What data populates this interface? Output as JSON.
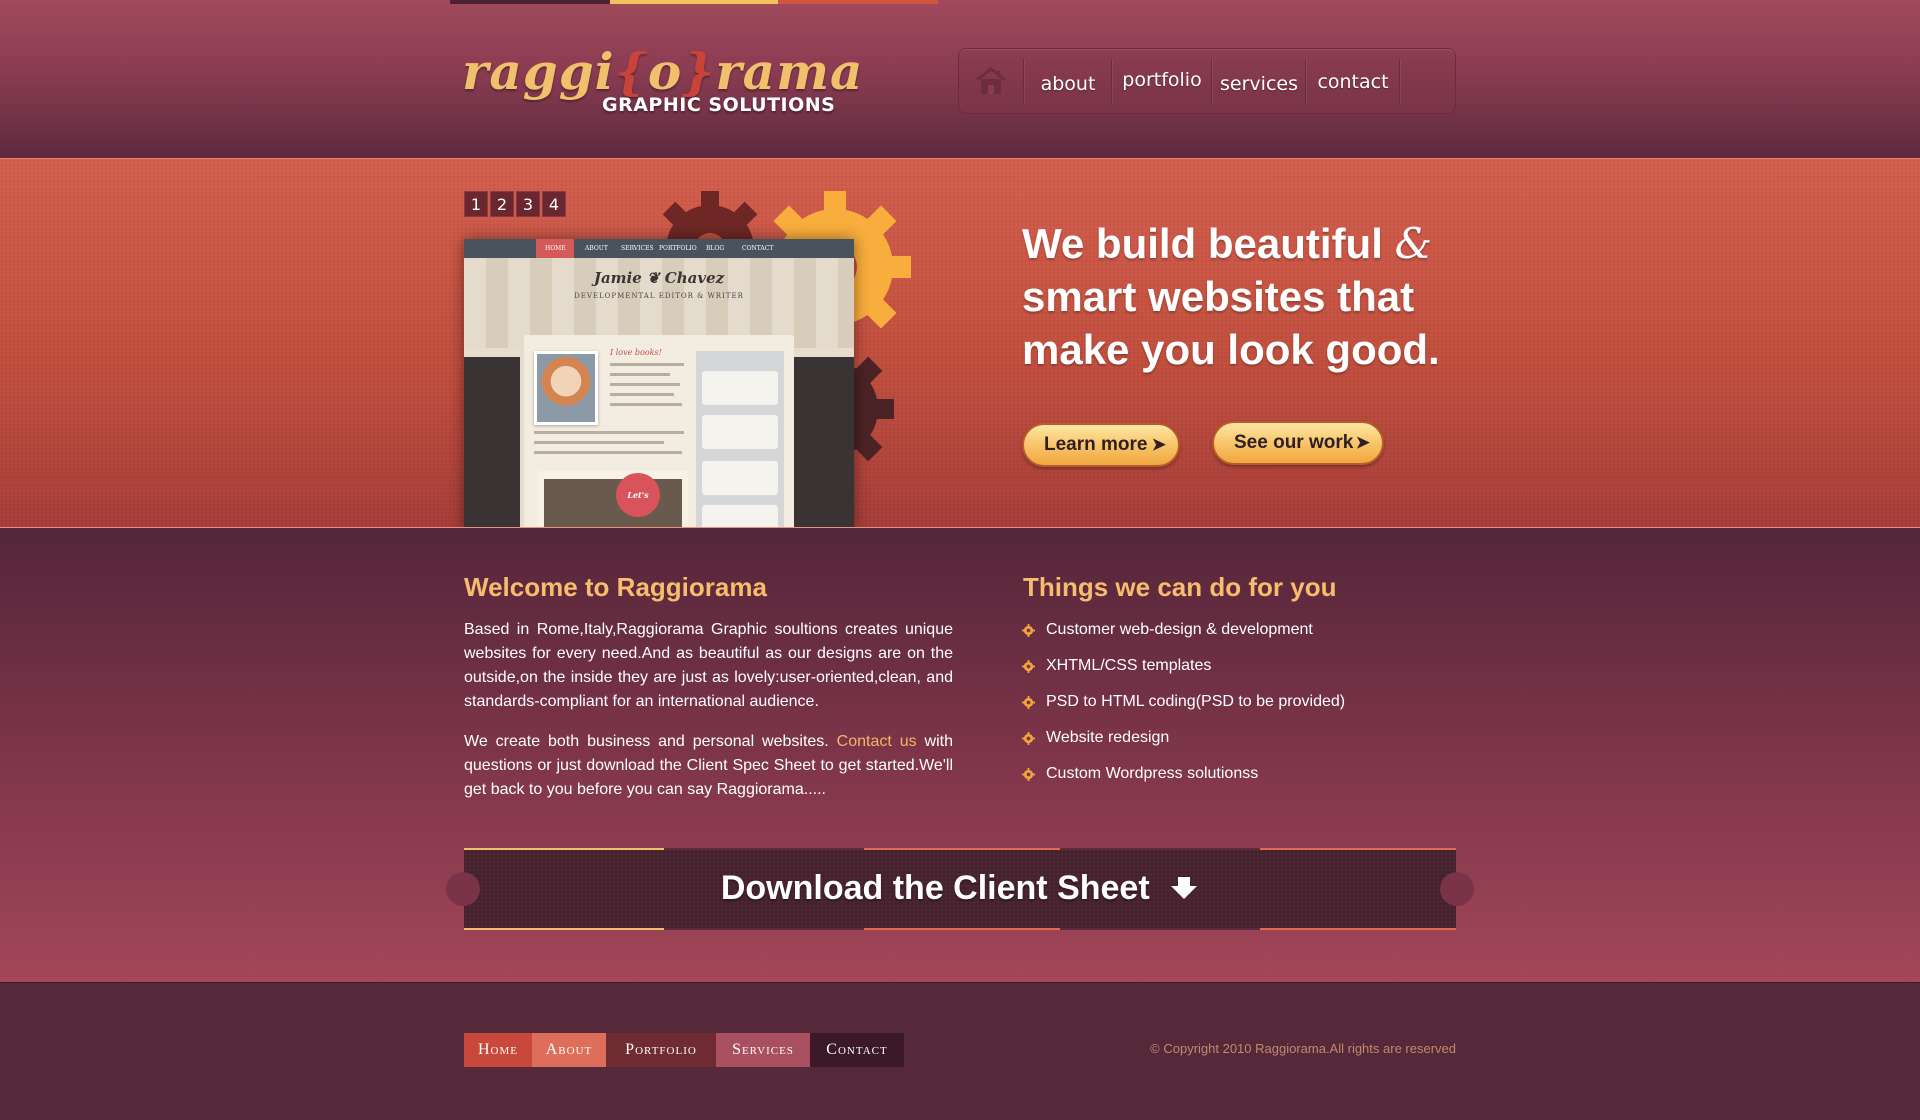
{
  "brand": {
    "logo_pre": "raggi",
    "logo_brace_open": "{",
    "logo_mid": "o",
    "logo_brace_close": "}",
    "logo_post": "rama",
    "tagline": "GRAPHIC SOLUTIONS"
  },
  "nav": {
    "home_icon": "house-icon",
    "items": [
      {
        "label": "about"
      },
      {
        "label": "portfolio"
      },
      {
        "label": "services"
      },
      {
        "label": "contact"
      }
    ]
  },
  "hero": {
    "slides": [
      "1",
      "2",
      "3",
      "4"
    ],
    "headline_line1": "We build beautiful",
    "headline_amp": "&",
    "headline_line2": "smart websites that",
    "headline_line3": "make you look good.",
    "learn_more": "Learn more",
    "see_our_work": "See our work",
    "button_arrow": "➤",
    "preview": {
      "tabs": [
        "HOME",
        "ABOUT",
        "SERVICES",
        "PORTFOLIO",
        "BLOG",
        "CONTACT"
      ],
      "name": "Jamie ❦ Chavez",
      "role": "DEVELOPMENTAL EDITOR & WRITER",
      "loves": "I love books!",
      "talk": "Let's talk!"
    }
  },
  "welcome": {
    "title": "Welcome to Raggiorama",
    "p1": "Based in Rome,Italy,Raggiorama Graphic soultions creates unique websites for every need.And as beautiful as our designs are on the outside,on the inside they are just as lovely:user-oriented,clean, and standards-compliant for an international audience.",
    "p2_before": "We create both business and personal websites. ",
    "p2_link": "Contact us",
    "p2_after": " with questions or just download the Client Spec Sheet to get started.We'll get back to you before you can say Raggiorama....."
  },
  "services": {
    "title": "Things we can do for you",
    "icon": "gear-bullet-icon",
    "items": [
      "Customer web-design & development",
      "XHTML/CSS templates",
      "PSD to HTML coding(PSD to be provided)",
      "Website redesign",
      "Custom Wordpress solutionss"
    ]
  },
  "download": {
    "label": "Download the Client Sheet",
    "icon": "download-arrow-icon"
  },
  "footer": {
    "links": [
      "Home",
      "About",
      "Portfolio",
      "Services",
      "Contact"
    ],
    "copyright": "© Copyright 2010 Raggiorama.All rights are reserved"
  },
  "colors": {
    "header_bg": "#8a3c52",
    "hero_bg": "#c2503f",
    "accent_gold": "#f7bc6e",
    "footer_tab_home": "#c8483c",
    "footer_tab_about": "#dd6e5a",
    "footer_tab_portfolio": "#6f2a32",
    "footer_tab_services": "#a85060",
    "footer_tab_contact": "#3b1929"
  }
}
